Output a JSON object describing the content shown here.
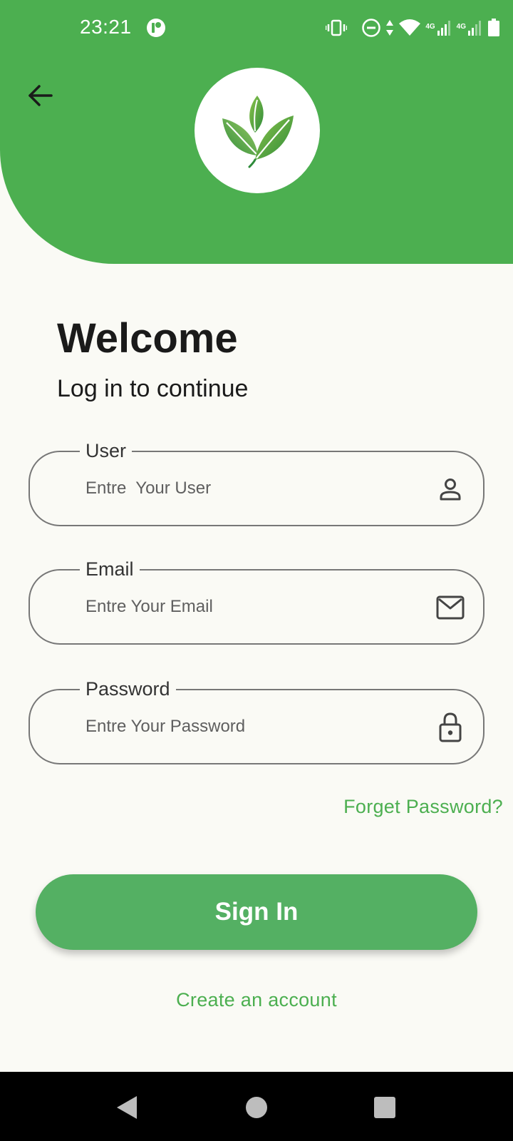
{
  "status_bar": {
    "time": "23:21",
    "network_label_1": "4G",
    "network_label_2": "4G"
  },
  "header": {
    "back_icon": "arrow-left-icon",
    "logo_icon": "leaf-logo-icon",
    "background_color": "#4caf50"
  },
  "main": {
    "title": "Welcome",
    "subtitle": "Log in to continue"
  },
  "form": {
    "user": {
      "label": "User",
      "placeholder": "Entre  Your User",
      "value": "",
      "icon": "person-icon"
    },
    "email": {
      "label": "Email",
      "placeholder": "Entre Your Email",
      "value": "",
      "icon": "mail-icon"
    },
    "password": {
      "label": "Password",
      "placeholder": "Entre Your Password",
      "value": "",
      "icon": "lock-icon"
    },
    "forget_password": "Forget Password?",
    "sign_in": "Sign In",
    "create_account": "Create an account"
  },
  "nav_bar": {
    "back": "triangle-back-icon",
    "home": "circle-home-icon",
    "recents": "square-recents-icon"
  },
  "colors": {
    "accent": "#4caf50",
    "button": "#54b063",
    "background": "#fafaf5",
    "text": "#1a1a1a"
  }
}
